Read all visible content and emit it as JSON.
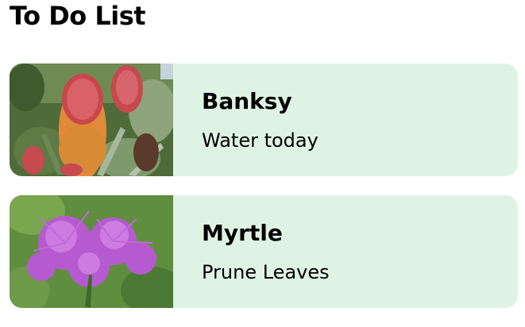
{
  "header": {
    "title": "To Do List"
  },
  "todos": [
    {
      "plant": "Banksy",
      "task": "Water today",
      "image_icon": "banksia-flower-photo"
    },
    {
      "plant": "Myrtle",
      "task": "Prune Leaves",
      "image_icon": "myrtle-flower-photo"
    }
  ],
  "colors": {
    "card_background": "#dff3e4",
    "text": "#000000"
  }
}
